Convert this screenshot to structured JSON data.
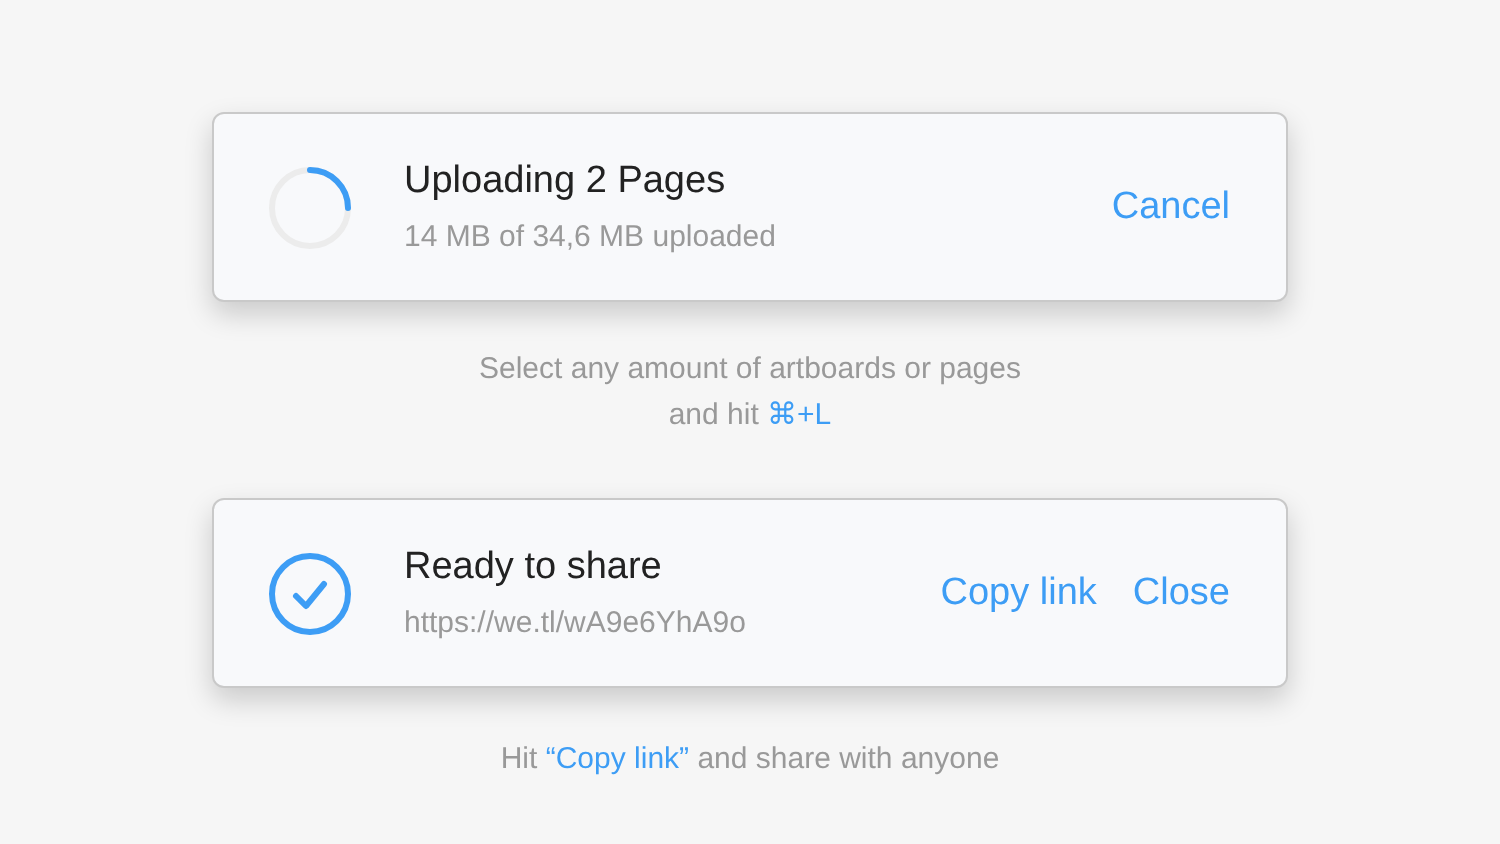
{
  "cards": [
    {
      "kind": "progress",
      "level": 0.25,
      "title": "Uploading 2 Pages",
      "subtitle": "14 MB of 34,6 MB uploaded",
      "actions": [
        "Cancel"
      ],
      "caption": [
        {
          "text": "Select any amount of artboards or pages",
          "highlight": false
        },
        {
          "text": "and hit",
          "highlight": false
        },
        {
          "text": "⌘+L",
          "highlight": true
        }
      ]
    },
    {
      "kind": "done",
      "title": "Ready to share",
      "subtitle": "https://we.tl/wA9e6YhA9o",
      "actions": [
        "Copy link",
        "Close"
      ],
      "caption": [
        {
          "text": "Hit",
          "highlight": false
        },
        {
          "text": "“Copy link”",
          "highlight": true
        },
        {
          "text": "and share with anyone",
          "highlight": false
        }
      ]
    }
  ]
}
